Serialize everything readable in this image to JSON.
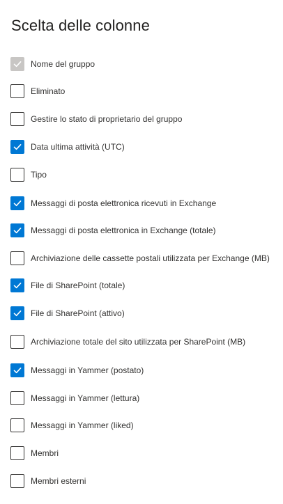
{
  "panel": {
    "title": "Scelta delle colonne"
  },
  "columns": [
    {
      "label": "Nome del gruppo",
      "state": "disabled-checked"
    },
    {
      "label": "Eliminato",
      "state": "unchecked"
    },
    {
      "label": "Gestire lo stato di proprietario del gruppo",
      "state": "unchecked"
    },
    {
      "label": "Data ultima attività (UTC)",
      "state": "checked"
    },
    {
      "label": "Tipo",
      "state": "unchecked"
    },
    {
      "label": "Messaggi di posta elettronica ricevuti in Exchange",
      "state": "checked"
    },
    {
      "label": "Messaggi di posta elettronica in Exchange (totale)",
      "state": "checked"
    },
    {
      "label": "Archiviazione delle cassette postali utilizzata per Exchange (MB)",
      "state": "unchecked"
    },
    {
      "label": "File di SharePoint (totale)",
      "state": "checked"
    },
    {
      "label": "File di SharePoint (attivo)",
      "state": "checked"
    },
    {
      "label": "Archiviazione totale del sito utilizzata per SharePoint (MB)",
      "state": "unchecked"
    },
    {
      "label": "Messaggi in Yammer (postato)",
      "state": "checked"
    },
    {
      "label": "Messaggi in Yammer (lettura)",
      "state": "unchecked"
    },
    {
      "label": "Messaggi in Yammer (liked)",
      "state": "unchecked"
    },
    {
      "label": "Membri",
      "state": "unchecked"
    },
    {
      "label": "Membri esterni",
      "state": "unchecked"
    }
  ],
  "colors": {
    "accent": "#0078d4",
    "disabled": "#c8c6c4",
    "text": "#323130"
  },
  "icons": {
    "check": "checkmark-icon"
  }
}
